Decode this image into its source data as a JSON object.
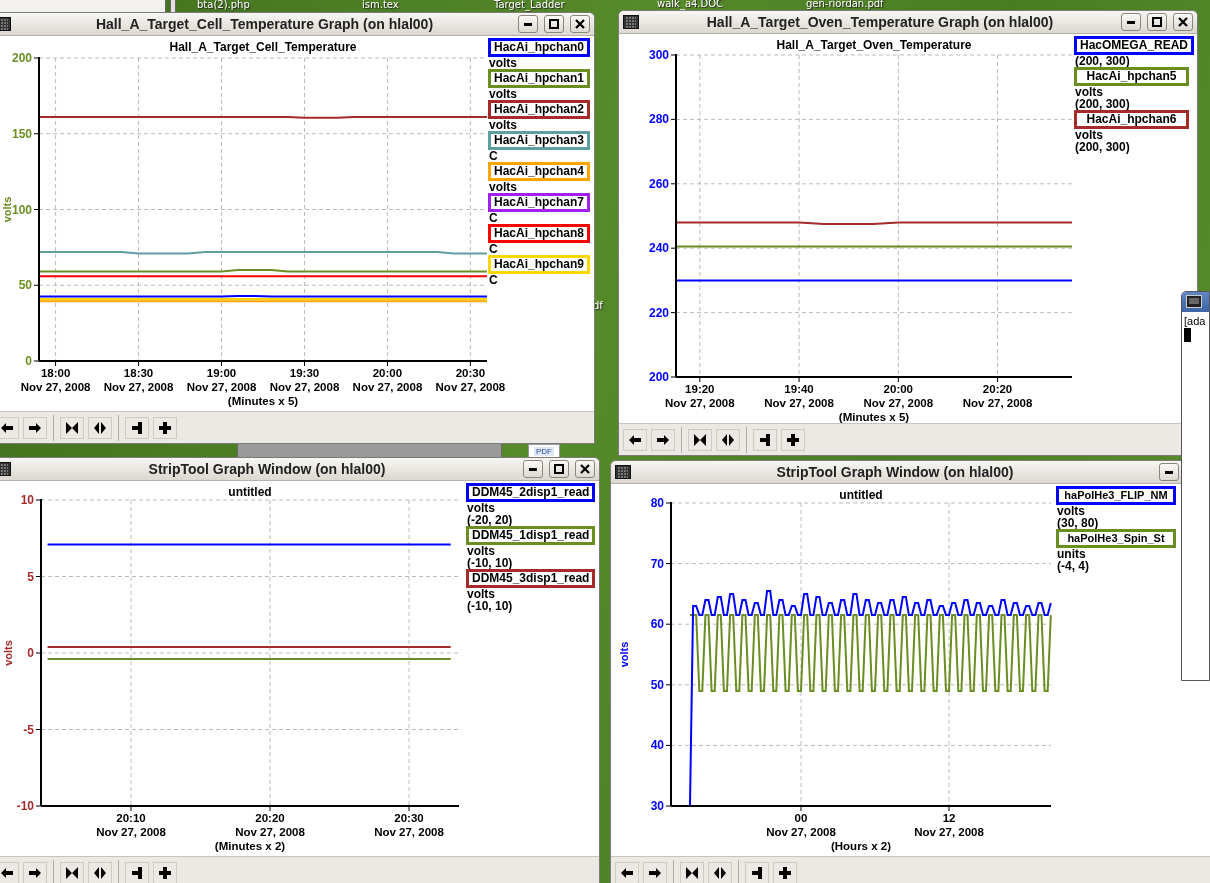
{
  "desktop": {
    "labels": [
      {
        "text": "bta(2).php"
      },
      {
        "text": "ism.tex"
      },
      {
        "text": "Target_Ladder"
      },
      {
        "text": "walk_a4.DOC"
      },
      {
        "text": "gen-riordan.pdf"
      },
      {
        "text": "df"
      }
    ],
    "pdf_icon_badge": "PDF"
  },
  "windows": [
    {
      "title": "Hall_A_Target_Cell_Temperature Graph (on hlal00)",
      "chart_data": {
        "type": "line",
        "title": "Hall_A_Target_Cell_Temperature",
        "ylabel": "volts",
        "xlabel": "(Minutes x 5)",
        "grid": true,
        "ylim": [
          0,
          200
        ],
        "yticks": [
          0,
          50,
          100,
          150,
          200
        ],
        "categories": [
          null,
          "18:00\nNov 27, 2008",
          null,
          null,
          null,
          null,
          "18:30\nNov 27, 2008",
          null,
          null,
          null,
          null,
          "19:00\nNov 27, 2008",
          null,
          null,
          null,
          null,
          "19:30\nNov 27, 2008",
          null,
          null,
          null,
          null,
          "20:00\nNov 27, 2008",
          null,
          null,
          null,
          null,
          "20:30\nNov 27, 2008",
          null
        ],
        "series": [
          {
            "name": "HacAi_hpchan0",
            "color": "#0000ff",
            "values": [
              42.5,
              42.5,
              42.5,
              42.5,
              42.5,
              42.5,
              42.5,
              42.5,
              42.5,
              42.5,
              42.5,
              42.5,
              43,
              43,
              42.5,
              42.5,
              42.5,
              42.5,
              42.5,
              42.5,
              42.5,
              42.5,
              42.5,
              42.5,
              42.5,
              42.5,
              42.5,
              42.5
            ]
          },
          {
            "name": "HacAi_hpchan1",
            "color": "#6b8e23",
            "values": [
              59,
              59,
              59,
              59,
              59,
              59,
              59,
              59,
              59,
              59,
              59,
              59,
              60,
              60,
              60,
              59,
              59,
              59,
              59,
              59,
              59,
              59,
              59,
              59,
              59,
              59,
              59,
              59
            ]
          },
          {
            "name": "HacAi_hpchan2",
            "color": "#a52a2a",
            "values": [
              161,
              161,
              161,
              161,
              161,
              161,
              161,
              161,
              161,
              161,
              161,
              161,
              161,
              161,
              161,
              161,
              160.5,
              160.5,
              160.5,
              161,
              161,
              161,
              161,
              161,
              161,
              161,
              161,
              161
            ]
          },
          {
            "name": "HacAi_hpchan3",
            "color": "#5f9ea0",
            "values": [
              72,
              72,
              72,
              72,
              72,
              72,
              71,
              71,
              71,
              71,
              72,
              72,
              72,
              72,
              72,
              72,
              72,
              72,
              72,
              72,
              72,
              72,
              72,
              72,
              72,
              71,
              71,
              71
            ]
          },
          {
            "name": "HacAi_hpchan4",
            "color": "#ffa500",
            "values": [
              39.5,
              39.5,
              39.5,
              39.5,
              39.5,
              39.5,
              39.5,
              39.5,
              39.5,
              39.5,
              39.5,
              39.5,
              39.5,
              39.5,
              39.5,
              39.5,
              39.5,
              39.5,
              39.5,
              39.5,
              39.5,
              39.5,
              39.5,
              39.5,
              39.5,
              39.5,
              39.5,
              39.5
            ]
          },
          {
            "name": "HacAi_hpchan7",
            "color": "#a020f0",
            "values": [
              null,
              null,
              null,
              null,
              null,
              null,
              null,
              null,
              null,
              null,
              null,
              null,
              null,
              null,
              null,
              null,
              null,
              null,
              null,
              null,
              null,
              null,
              null,
              null,
              null,
              null,
              null,
              null
            ]
          },
          {
            "name": "HacAi_hpchan8",
            "color": "#ff0000",
            "values": [
              56,
              56,
              56,
              56,
              56,
              56,
              56,
              56,
              56,
              56,
              56,
              56,
              56,
              56,
              56,
              56,
              56,
              56,
              56,
              56,
              56,
              56,
              56,
              56,
              56,
              56,
              56,
              56
            ]
          },
          {
            "name": "HacAi_hpchan9",
            "color": "#ffd700",
            "values": [
              41,
              41,
              41,
              41,
              41,
              41,
              41,
              41,
              41,
              41,
              41,
              41,
              41,
              41,
              41,
              41,
              41,
              41,
              41,
              41,
              41,
              41,
              41,
              41,
              41,
              41,
              41,
              41
            ]
          }
        ]
      },
      "legend": [
        {
          "unit": "volts"
        },
        {
          "unit": "volts"
        },
        {
          "unit": "volts"
        },
        {
          "unit": "C"
        },
        {
          "unit": "volts"
        },
        {
          "unit": "C"
        },
        {
          "unit": "C"
        },
        {
          "unit": "C"
        }
      ]
    },
    {
      "title": "Hall_A_Target_Oven_Temperature Graph (on hlal00)",
      "chart_data": {
        "type": "line",
        "title": "Hall_A_Target_Oven_Temperature",
        "xlabel": "(Minutes x 5)",
        "grid": true,
        "ylim": [
          200,
          300
        ],
        "yticks": [
          200,
          220,
          240,
          260,
          280,
          300
        ],
        "categories": [
          null,
          "19:20\nNov 27, 2008",
          null,
          null,
          null,
          "19:40\nNov 27, 2008",
          null,
          null,
          null,
          "20:00\nNov 27, 2008",
          null,
          null,
          null,
          "20:20\nNov 27, 2008",
          null,
          null,
          null
        ],
        "series": [
          {
            "name": "HacOMEGA_READ",
            "color": "#0000ff",
            "values": [
              230,
              230,
              230,
              230,
              230,
              230,
              230,
              230,
              230,
              230,
              230,
              230,
              230,
              230,
              230,
              230,
              230
            ]
          },
          {
            "name": "HacAi_hpchan5",
            "color": "#6b8e23",
            "values": [
              240.5,
              240.5,
              240.5,
              240.5,
              240.5,
              240.5,
              240.5,
              240.5,
              240.5,
              240.5,
              240.5,
              240.5,
              240.5,
              240.5,
              240.5,
              240.5,
              240.5
            ]
          },
          {
            "name": "HacAi_hpchan6",
            "color": "#a52a2a",
            "values": [
              248,
              248,
              248,
              248,
              248,
              248,
              247.5,
              247.5,
              247.5,
              248,
              248,
              248,
              248,
              248,
              248,
              248,
              248
            ]
          }
        ]
      },
      "legend": [
        {
          "range": "(200, 300)"
        },
        {
          "unit": "volts",
          "range": "(200, 300)"
        },
        {
          "unit": "volts",
          "range": "(200, 300)"
        }
      ]
    },
    {
      "title": "StripTool Graph Window (on hlal00)",
      "chart_data": {
        "type": "line",
        "title": "untitled",
        "ylabel": "volts",
        "xlabel": "(Minutes x 2)",
        "grid": true,
        "ylim": [
          -10,
          10
        ],
        "yticks": [
          -10,
          -5,
          0,
          5,
          10
        ],
        "categories": [
          null,
          null,
          null,
          null,
          null,
          null,
          "20:10\nNov 27, 2008",
          null,
          null,
          null,
          null,
          null,
          null,
          null,
          null,
          null,
          "20:20\nNov 27, 2008",
          null,
          null,
          null,
          null,
          null,
          null,
          null,
          null,
          null,
          "20:30\nNov 27, 2008",
          null,
          null,
          null
        ],
        "series": [
          {
            "name": "DDM45_2disp1_read",
            "color": "#0000ff",
            "values": [
              7.1,
              7.1,
              7.1,
              7.1,
              7.1,
              7.1,
              7.1,
              7.1,
              7.1,
              7.1,
              7.1,
              7.1,
              7.1,
              7.1,
              7.1,
              7.1,
              7.1,
              7.1,
              7.1,
              7.1,
              7.1,
              7.1,
              7.1,
              7.1,
              7.1,
              7.1,
              7.1,
              7.1,
              7.1,
              7.1
            ]
          },
          {
            "name": "DDM45_1disp1_read",
            "color": "#6b8e23",
            "values": [
              -0.4,
              -0.4,
              -0.4,
              -0.4,
              -0.4,
              -0.4,
              -0.4,
              -0.4,
              -0.4,
              -0.4,
              -0.4,
              -0.4,
              -0.4,
              -0.4,
              -0.4,
              -0.4,
              -0.4,
              -0.4,
              -0.4,
              -0.4,
              -0.4,
              -0.4,
              -0.4,
              -0.4,
              -0.4,
              -0.4,
              -0.4,
              -0.4,
              -0.4,
              -0.4
            ]
          },
          {
            "name": "DDM45_3disp1_read",
            "color": "#a52a2a",
            "values": [
              0.4,
              0.4,
              0.4,
              0.4,
              0.4,
              0.4,
              0.4,
              0.4,
              0.4,
              0.4,
              0.4,
              0.4,
              0.4,
              0.4,
              0.4,
              0.4,
              0.4,
              0.4,
              0.4,
              0.4,
              0.4,
              0.4,
              0.4,
              0.4,
              0.4,
              0.4,
              0.4,
              0.4,
              0.4,
              0.4
            ]
          }
        ]
      },
      "legend": [
        {
          "unit": "volts",
          "range": "(-20, 20)"
        },
        {
          "unit": "volts",
          "range": "(-10, 10)"
        },
        {
          "unit": "volts",
          "range": "(-10, 10)"
        }
      ]
    },
    {
      "title": "StripTool Graph Window (on hlal00)",
      "chart_data": {
        "type": "line",
        "title": "untitled",
        "ylabel": "volts",
        "xlabel": "(Hours x 2)",
        "grid": true,
        "ylim": [
          30,
          80
        ],
        "yticks": [
          30,
          40,
          50,
          60,
          70,
          80
        ],
        "categories": [
          null,
          null,
          null,
          null,
          null,
          null,
          null,
          null,
          null,
          null,
          null,
          null,
          null,
          null,
          null,
          null,
          null,
          null,
          null,
          null,
          null,
          null,
          null,
          null,
          null,
          null,
          null,
          null,
          null,
          null,
          null,
          null,
          null,
          null,
          null,
          null,
          "00\nNov 27, 2008",
          null,
          null,
          null,
          null,
          null,
          null,
          null,
          null,
          null,
          null,
          null,
          null,
          null,
          null,
          null,
          null,
          null,
          null,
          null,
          null,
          null,
          null,
          null,
          null,
          null,
          null,
          null,
          null,
          null,
          null,
          null,
          null,
          null,
          null,
          null,
          null,
          null,
          null,
          null,
          null,
          null,
          null,
          null,
          null,
          null,
          null,
          null,
          "12\nNov 27, 2008",
          null,
          null,
          null,
          null,
          null,
          null,
          null,
          null,
          null,
          null,
          null,
          null,
          null,
          null,
          null,
          null,
          null,
          null,
          null,
          null,
          null,
          null,
          null,
          null,
          null,
          null,
          null,
          null,
          null,
          null,
          null,
          null,
          null
        ],
        "series": [
          {
            "name": "haPolHe3_FLIP_NM",
            "color": "#0000ff",
            "values": [
              30,
              63,
              63,
              61.5,
              61.5,
              64,
              64,
              61.5,
              61.5,
              64.5,
              64.5,
              61.5,
              61.5,
              65,
              65,
              61.5,
              61.5,
              64,
              64,
              61.5,
              61.5,
              63.5,
              63.5,
              61.5,
              61.5,
              65.5,
              65.5,
              61.5,
              61.5,
              64,
              64,
              61.5,
              61.5,
              63,
              63,
              61.5,
              61.5,
              65,
              65,
              61.5,
              61.5,
              64.5,
              64.5,
              61.5,
              61.5,
              63.5,
              63.5,
              61.5,
              61.5,
              64,
              64,
              61.5,
              61.5,
              65,
              65,
              61.5,
              61.5,
              64,
              64,
              61.5,
              61.5,
              63.5,
              63.5,
              61.5,
              61.5,
              64,
              64,
              61.5,
              61.5,
              64.5,
              64.5,
              61.5,
              61.5,
              63.5,
              63.5,
              61.5,
              61.5,
              64,
              64,
              61.5,
              61.5,
              63,
              63,
              61.5,
              61.5,
              63.5,
              63.5,
              61.5,
              61.5,
              64,
              64,
              61.5,
              61.5,
              63.5,
              63.5,
              61.5,
              61.5,
              63,
              63,
              61.5,
              61.5,
              64,
              64,
              61.5,
              61.5,
              63.5,
              63.5,
              61.5,
              61.5,
              63,
              63,
              61.5,
              61.5,
              63.5,
              63.5,
              61.5,
              61.5,
              63.5
            ]
          },
          {
            "name": "haPolHe3_Spin_St",
            "color": "#6b8e23",
            "values": [
              61.5,
              61.5,
              61.5,
              49,
              49,
              61.5,
              61.5,
              49,
              49,
              61.5,
              61.5,
              49,
              49,
              61.5,
              61.5,
              49,
              49,
              61.5,
              61.5,
              49,
              49,
              61.5,
              61.5,
              49,
              49,
              61.5,
              61.5,
              49,
              49,
              61.5,
              61.5,
              49,
              49,
              61.5,
              61.5,
              49,
              49,
              61.5,
              61.5,
              49,
              49,
              61.5,
              61.5,
              49,
              49,
              61.5,
              61.5,
              49,
              49,
              61.5,
              61.5,
              49,
              49,
              61.5,
              61.5,
              49,
              49,
              61.5,
              61.5,
              49,
              49,
              61.5,
              61.5,
              49,
              49,
              61.5,
              61.5,
              49,
              49,
              61.5,
              61.5,
              49,
              49,
              61.5,
              61.5,
              49,
              49,
              61.5,
              61.5,
              49,
              49,
              61.5,
              61.5,
              49,
              49,
              61.5,
              61.5,
              49,
              49,
              61.5,
              61.5,
              49,
              49,
              61.5,
              61.5,
              49,
              49,
              61.5,
              61.5,
              49,
              49,
              61.5,
              61.5,
              49,
              49,
              61.5,
              61.5,
              49,
              49,
              61.5,
              61.5,
              49,
              49,
              61.5,
              61.5,
              49,
              49,
              61.5
            ]
          }
        ]
      },
      "legend": [
        {
          "unit": "volts",
          "range": "(30, 80)"
        },
        {
          "unit": "units",
          "range": "(-4, 4)"
        }
      ]
    }
  ],
  "terminal": {
    "text": "[ada"
  }
}
